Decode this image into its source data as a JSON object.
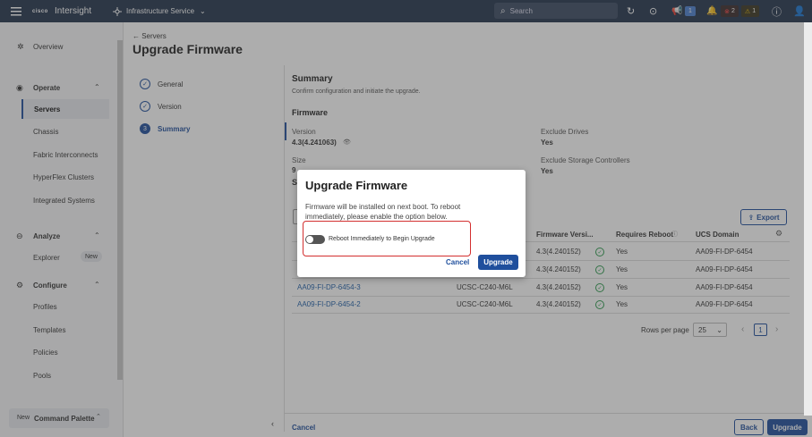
{
  "topbar": {
    "brand": "Intersight",
    "service": "Infrastructure Service",
    "search_placeholder": "Search",
    "announce_count": "1",
    "alert_critical": "2",
    "alert_warning": "1"
  },
  "sidebar": {
    "overview": "Overview",
    "operate": "Operate",
    "operate_items": [
      "Servers",
      "Chassis",
      "Fabric Interconnects",
      "HyperFlex Clusters",
      "Integrated Systems"
    ],
    "analyze": "Analyze",
    "explorer": "Explorer",
    "new_badge": "New",
    "configure": "Configure",
    "configure_items": [
      "Profiles",
      "Templates",
      "Policies",
      "Pools"
    ],
    "command_new": "New",
    "command_palette": "Command Palette"
  },
  "page": {
    "breadcrumb": "← Servers",
    "title": "Upgrade Firmware",
    "steps": [
      {
        "num": "",
        "label": "General"
      },
      {
        "num": "",
        "label": "Version"
      },
      {
        "num": "3",
        "label": "Summary"
      }
    ]
  },
  "summary": {
    "title": "Summary",
    "subtitle": "Confirm configuration and initiate the upgrade.",
    "firmware_heading": "Firmware",
    "version_label": "Version",
    "version_value": "4.3(4.241063)",
    "exclude_drives_label": "Exclude Drives",
    "exclude_drives_value": "Yes",
    "size_label": "Size",
    "size_value": "9",
    "exclude_storage_label": "Exclude Storage Controllers",
    "exclude_storage_value": "Yes",
    "s_heading": "S",
    "export": "Export"
  },
  "table": {
    "headers": [
      "Firmware Versi...",
      "Requires Reboot",
      "UCS Domain"
    ],
    "rows": [
      {
        "name": "",
        "model": "",
        "firmware": "4.3(4.240152)",
        "reboot": "Yes",
        "domain": "AA09-FI-DP-6454"
      },
      {
        "name": "",
        "model": "",
        "firmware": "4.3(4.240152)",
        "reboot": "Yes",
        "domain": "AA09-FI-DP-6454"
      },
      {
        "name": "AA09-FI-DP-6454-3",
        "model": "UCSC-C240-M6L",
        "firmware": "4.3(4.240152)",
        "reboot": "Yes",
        "domain": "AA09-FI-DP-6454"
      },
      {
        "name": "AA09-FI-DP-6454-2",
        "model": "UCSC-C240-M6L",
        "firmware": "4.3(4.240152)",
        "reboot": "Yes",
        "domain": "AA09-FI-DP-6454"
      }
    ],
    "rows_per_page_label": "Rows per page",
    "rows_per_page_value": "25",
    "page_num": "1"
  },
  "footer": {
    "cancel": "Cancel",
    "back": "Back",
    "upgrade": "Upgrade"
  },
  "modal": {
    "title": "Upgrade Firmware",
    "body": "Firmware will be installed on next boot. To reboot immediately, please enable the option below.",
    "toggle_label": "Reboot Immediately to Begin Upgrade",
    "cancel": "Cancel",
    "upgrade": "Upgrade"
  },
  "colors": {
    "topbar": "#24344d",
    "primary": "#1f4f9d",
    "highlight": "#d32f2f"
  }
}
